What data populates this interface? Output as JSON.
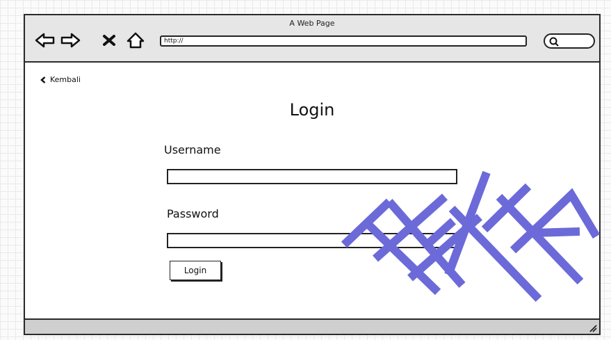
{
  "window": {
    "title": "A Web Page"
  },
  "toolbar": {
    "url": "http://",
    "icons": [
      "arrow-left-icon",
      "arrow-right-icon",
      "close-icon",
      "home-icon",
      "search-icon"
    ]
  },
  "page": {
    "back_label": "Kembali",
    "title": "Login",
    "username_label": "Username",
    "username_value": "",
    "password_label": "Password",
    "password_value": "",
    "submit_label": "Login"
  },
  "overlay": {
    "watermark_text": "TEKTIKA"
  },
  "colors": {
    "frame": "#2b2b2b",
    "titlebar": "#e6e6e6",
    "statusbar": "#cfcfcf",
    "watermark": "#6c6ad8"
  }
}
